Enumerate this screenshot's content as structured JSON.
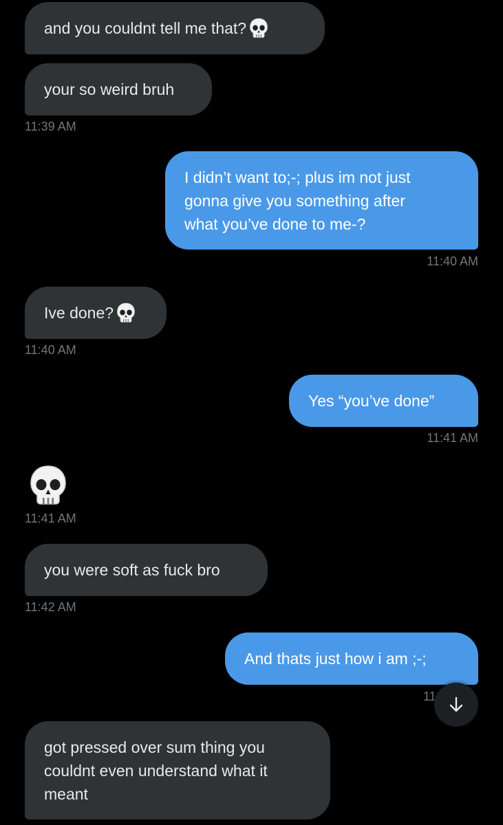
{
  "messages": [
    {
      "direction": "in",
      "text": "and you couldnt tell me that?",
      "emoji": "skull-icon"
    },
    {
      "direction": "in",
      "text": "your so weird bruh",
      "time": "11:39 AM"
    },
    {
      "direction": "out",
      "lines": [
        "I didn’t want to;-; plus im not just",
        "gonna give you something after",
        "what you’ve done to me-?"
      ],
      "time": "11:40 AM"
    },
    {
      "direction": "in",
      "text": "Ive done?",
      "emoji": "skull-icon",
      "time": "11:40 AM"
    },
    {
      "direction": "out",
      "text": "Yes “you’ve done”",
      "time": "11:41 AM"
    },
    {
      "direction": "in",
      "emoji": "skull-icon",
      "time": "11:41 AM"
    },
    {
      "direction": "in",
      "text": "you were soft as fuck bro",
      "time": "11:42 AM"
    },
    {
      "direction": "out",
      "text": "And thats just how i am ;-;",
      "time_partial": "11"
    },
    {
      "direction": "in",
      "lines": [
        "got pressed over sum thing you",
        "couldnt even understand what it",
        "meant"
      ]
    }
  ],
  "scroll_button": {
    "icon": "arrow-down-icon"
  },
  "colors": {
    "background": "#000000",
    "incoming_bubble": "#2f3336",
    "outgoing_bubble": "#4a99e9",
    "timestamp": "#71767b"
  }
}
